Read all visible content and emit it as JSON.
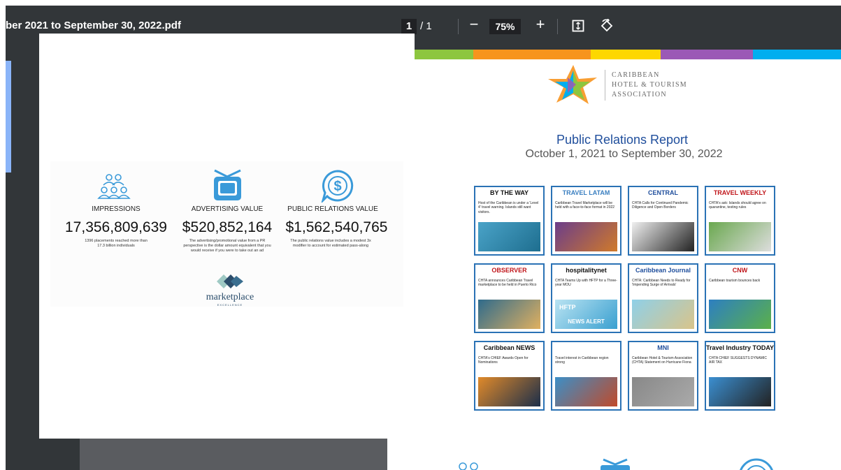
{
  "toolbar": {
    "doc_title": "ber 2021 to September 30, 2022.pdf",
    "page_current": "1",
    "page_total": "/ 1",
    "zoom_out": "−",
    "zoom": "75%",
    "zoom_in": "+",
    "fit_icon": "fit-page-icon",
    "rotate_icon": "rotate-icon"
  },
  "slide": {
    "metrics": [
      {
        "icon": "people-icon",
        "label": "IMPRESSIONS",
        "value": "17,356,809,639",
        "desc": "1396 placements reached more than 17.3 billion individuals"
      },
      {
        "icon": "tv-icon",
        "label": "ADVERTISING VALUE",
        "value": "$520,852,164",
        "desc": "The advertising/promotional value from a PR perspective is the dollar amount equivalent that you would receive if you were to take out an ad"
      },
      {
        "icon": "dollar-chat-icon",
        "label": "PUBLIC RELATIONS VALUE",
        "value": "$1,562,540,765",
        "desc": "The public relations value includes a modest 3x modifier to account for estimated pass-along"
      }
    ],
    "logo_text": "marketplace",
    "logo_sub": "EXCELLENCE"
  },
  "report": {
    "org_line1": "CARIBBEAN",
    "org_line2": "HOTEL & TOURISM",
    "org_line3": "ASSOCIATION",
    "title": "Public Relations Report",
    "subtitle": "October 1, 2021 to September 30, 2022"
  },
  "colors": {
    "toolbar": "#323639",
    "title_blue": "#1f4e9c",
    "card_border": "#2a72b5",
    "strip": [
      "#8dc63f",
      "#f7941d",
      "#fdd700",
      "#9b59b6",
      "#00aeef"
    ]
  },
  "cards": [
    {
      "brand": "BY THE WAY",
      "text": "Host of the Caribbean is under a 'Level 4' travel warning. Islands still want visitors."
    },
    {
      "brand": "TRAVEL LATAM",
      "text": "Caribbean Travel Marketplace will be held with a face-to-face format in 2022"
    },
    {
      "brand": "CENTRAL",
      "text": "CHTA Calls for Continued Pandemic Diligence and Open Borders"
    },
    {
      "brand": "TRAVEL WEEKLY",
      "text": "CHTA's ask: Islands should agree on quarantine, testing rules"
    },
    {
      "brand": "OBSERVER",
      "text": "CHTA announces Caribbean Travel marketplace to be held in Puerto Rico"
    },
    {
      "brand": "hospitalitynet",
      "text": "CHTA Teams Up with HFTP for a Three-year MOU"
    },
    {
      "brand": "Caribbean Journal",
      "text": "CHTA: Caribbean Needs to Ready for 'Impending Surge of Arrivals'"
    },
    {
      "brand": "CNW",
      "text": "Caribbean tourism bounces back"
    },
    {
      "brand": "Caribbean NEWS",
      "text": "CHTA's CHIEF Awards Open for Nominations"
    },
    {
      "brand": "",
      "text": "Travel interest in Caribbean region strong"
    },
    {
      "brand": "MNI",
      "text": "Caribbean Hotel & Tourism Association (CHTA) Statement on Hurricane Fiona"
    },
    {
      "brand": "Travel Industry TODAY",
      "text": "CHTA CHIEF SUGGESTS DYNAMIC AIR TAX"
    }
  ],
  "hftp_badge": "HFTP",
  "news_alert": "NEWS ALERT"
}
